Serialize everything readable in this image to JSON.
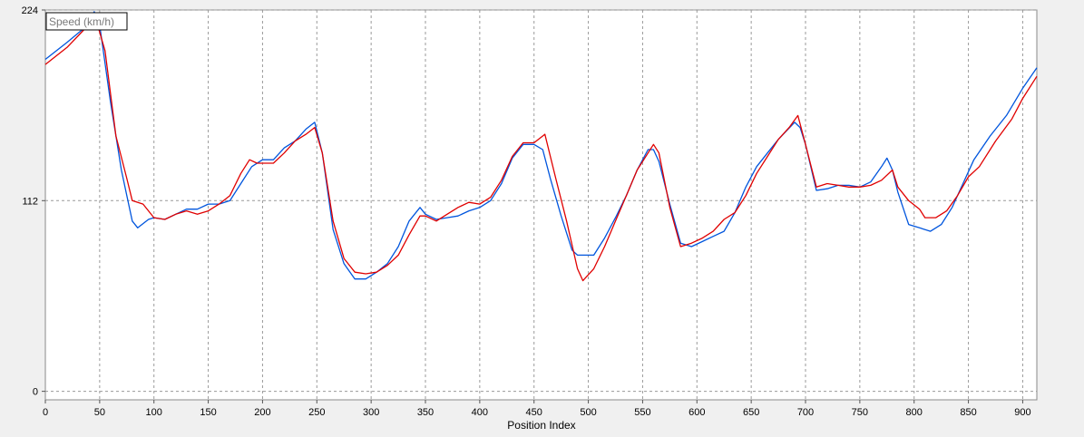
{
  "chart_data": {
    "type": "line",
    "title": "",
    "xlabel": "Position Index",
    "ylabel": "",
    "legend_box_label": "Speed (km/h)",
    "legend_placement": "top-left",
    "grid": true,
    "xlim": [
      0,
      913
    ],
    "ylim": [
      -5,
      224
    ],
    "x_ticks": [
      0,
      50,
      100,
      150,
      200,
      250,
      300,
      350,
      400,
      450,
      500,
      550,
      600,
      650,
      700,
      750,
      800,
      850,
      900
    ],
    "y_ticks": [
      0,
      112,
      224
    ],
    "series": [
      {
        "color": "#0055dd",
        "points": [
          [
            0,
            195
          ],
          [
            20,
            205
          ],
          [
            35,
            213
          ],
          [
            45,
            223
          ],
          [
            50,
            215
          ],
          [
            60,
            170
          ],
          [
            70,
            130
          ],
          [
            75,
            115
          ],
          [
            80,
            100
          ],
          [
            85,
            96
          ],
          [
            95,
            101
          ],
          [
            100,
            102
          ],
          [
            110,
            101
          ],
          [
            120,
            104
          ],
          [
            130,
            107
          ],
          [
            140,
            107
          ],
          [
            150,
            110
          ],
          [
            160,
            110
          ],
          [
            170,
            112
          ],
          [
            180,
            122
          ],
          [
            190,
            132
          ],
          [
            200,
            136
          ],
          [
            210,
            136
          ],
          [
            220,
            143
          ],
          [
            230,
            147
          ],
          [
            240,
            154
          ],
          [
            248,
            158
          ],
          [
            255,
            140
          ],
          [
            265,
            95
          ],
          [
            275,
            75
          ],
          [
            285,
            66
          ],
          [
            295,
            66
          ],
          [
            305,
            70
          ],
          [
            315,
            75
          ],
          [
            325,
            85
          ],
          [
            335,
            100
          ],
          [
            345,
            108
          ],
          [
            350,
            104
          ],
          [
            360,
            101
          ],
          [
            370,
            102
          ],
          [
            380,
            103
          ],
          [
            390,
            106
          ],
          [
            400,
            108
          ],
          [
            410,
            112
          ],
          [
            420,
            122
          ],
          [
            430,
            137
          ],
          [
            440,
            145
          ],
          [
            450,
            145
          ],
          [
            458,
            142
          ],
          [
            465,
            125
          ],
          [
            475,
            103
          ],
          [
            485,
            83
          ],
          [
            490,
            80
          ],
          [
            500,
            80
          ],
          [
            505,
            80
          ],
          [
            515,
            90
          ],
          [
            525,
            102
          ],
          [
            535,
            115
          ],
          [
            545,
            130
          ],
          [
            555,
            142
          ],
          [
            560,
            142
          ],
          [
            565,
            135
          ],
          [
            575,
            110
          ],
          [
            585,
            87
          ],
          [
            595,
            85
          ],
          [
            605,
            88
          ],
          [
            615,
            91
          ],
          [
            625,
            94
          ],
          [
            635,
            105
          ],
          [
            645,
            120
          ],
          [
            655,
            132
          ],
          [
            665,
            140
          ],
          [
            675,
            148
          ],
          [
            690,
            158
          ],
          [
            695,
            155
          ],
          [
            700,
            145
          ],
          [
            710,
            118
          ],
          [
            720,
            119
          ],
          [
            730,
            121
          ],
          [
            740,
            121
          ],
          [
            750,
            120
          ],
          [
            760,
            123
          ],
          [
            770,
            132
          ],
          [
            775,
            137
          ],
          [
            780,
            130
          ],
          [
            785,
            117
          ],
          [
            795,
            98
          ],
          [
            805,
            96
          ],
          [
            815,
            94
          ],
          [
            825,
            98
          ],
          [
            835,
            108
          ],
          [
            845,
            122
          ],
          [
            855,
            136
          ],
          [
            870,
            150
          ],
          [
            885,
            162
          ],
          [
            900,
            178
          ],
          [
            913,
            190
          ]
        ]
      },
      {
        "color": "#e00000",
        "points": [
          [
            0,
            192
          ],
          [
            20,
            202
          ],
          [
            35,
            212
          ],
          [
            45,
            222
          ],
          [
            55,
            200
          ],
          [
            65,
            150
          ],
          [
            75,
            125
          ],
          [
            80,
            112
          ],
          [
            90,
            110
          ],
          [
            100,
            102
          ],
          [
            110,
            101
          ],
          [
            120,
            104
          ],
          [
            130,
            106
          ],
          [
            140,
            104
          ],
          [
            150,
            106
          ],
          [
            160,
            110
          ],
          [
            170,
            115
          ],
          [
            180,
            128
          ],
          [
            188,
            136
          ],
          [
            195,
            134
          ],
          [
            210,
            134
          ],
          [
            220,
            140
          ],
          [
            230,
            147
          ],
          [
            240,
            151
          ],
          [
            248,
            155
          ],
          [
            255,
            140
          ],
          [
            265,
            100
          ],
          [
            275,
            78
          ],
          [
            285,
            70
          ],
          [
            295,
            69
          ],
          [
            305,
            70
          ],
          [
            315,
            74
          ],
          [
            325,
            80
          ],
          [
            335,
            92
          ],
          [
            345,
            103
          ],
          [
            350,
            103
          ],
          [
            360,
            100
          ],
          [
            370,
            104
          ],
          [
            380,
            108
          ],
          [
            390,
            111
          ],
          [
            400,
            110
          ],
          [
            410,
            114
          ],
          [
            420,
            124
          ],
          [
            430,
            138
          ],
          [
            440,
            146
          ],
          [
            450,
            146
          ],
          [
            460,
            151
          ],
          [
            470,
            125
          ],
          [
            480,
            100
          ],
          [
            490,
            72
          ],
          [
            495,
            65
          ],
          [
            505,
            72
          ],
          [
            515,
            85
          ],
          [
            525,
            100
          ],
          [
            535,
            115
          ],
          [
            545,
            130
          ],
          [
            560,
            145
          ],
          [
            565,
            140
          ],
          [
            575,
            108
          ],
          [
            585,
            85
          ],
          [
            595,
            87
          ],
          [
            605,
            90
          ],
          [
            615,
            94
          ],
          [
            625,
            101
          ],
          [
            635,
            105
          ],
          [
            645,
            115
          ],
          [
            655,
            128
          ],
          [
            665,
            138
          ],
          [
            675,
            148
          ],
          [
            685,
            155
          ],
          [
            693,
            162
          ],
          [
            700,
            145
          ],
          [
            710,
            120
          ],
          [
            720,
            122
          ],
          [
            730,
            121
          ],
          [
            740,
            120
          ],
          [
            750,
            120
          ],
          [
            760,
            121
          ],
          [
            770,
            124
          ],
          [
            780,
            130
          ],
          [
            785,
            120
          ],
          [
            795,
            112
          ],
          [
            805,
            107
          ],
          [
            810,
            102
          ],
          [
            820,
            102
          ],
          [
            830,
            106
          ],
          [
            840,
            115
          ],
          [
            850,
            126
          ],
          [
            860,
            132
          ],
          [
            875,
            147
          ],
          [
            890,
            160
          ],
          [
            900,
            172
          ],
          [
            913,
            185
          ]
        ]
      }
    ]
  }
}
